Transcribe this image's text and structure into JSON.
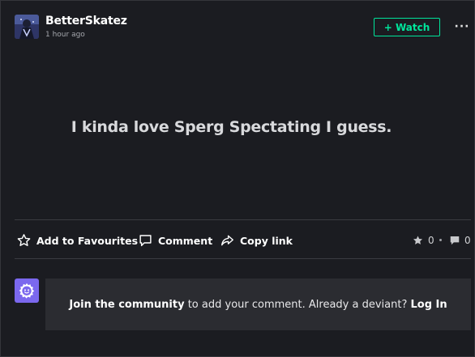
{
  "post": {
    "author": "BetterSkatez",
    "time": "1 hour ago",
    "watch_label": "+ Watch",
    "more_label": "···",
    "status": "I kinda love Sperg Spectating I guess."
  },
  "actions": {
    "favourite_label": "Add to Favourites",
    "comment_label": "Comment",
    "copy_label": "Copy link"
  },
  "stats": {
    "favourites": "0",
    "comments": "0"
  },
  "join": {
    "link_text": "Join the community",
    "middle_text": " to add your comment. Already a deviant? ",
    "login_text": "Log In"
  },
  "colors": {
    "accent": "#00e59b",
    "background": "#1b1c21",
    "panel": "#2b2c31",
    "community_avatar": "#7b68ee"
  },
  "icons": {
    "favourite": "star-outline-icon",
    "comment": "speech-bubble-icon",
    "copy": "share-arrow-icon",
    "fav_stat": "star-filled-icon",
    "comment_stat": "speech-bubble-filled-icon",
    "community": "deviantart-gear-face-icon"
  }
}
